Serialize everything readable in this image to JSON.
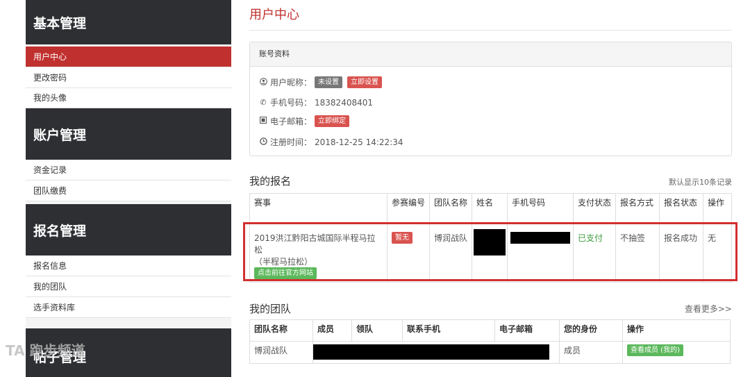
{
  "sidebar": {
    "sections": [
      {
        "title": "基本管理",
        "items": [
          "用户中心",
          "更改密码",
          "我的头像"
        ]
      },
      {
        "title": "账户管理",
        "items": [
          "资金记录",
          "团队缴费"
        ]
      },
      {
        "title": "报名管理",
        "items": [
          "报名信息",
          "我的团队",
          "选手资料库"
        ]
      },
      {
        "title": "帖子管理",
        "items": []
      }
    ],
    "active_item": "用户中心"
  },
  "page": {
    "title": "用户中心"
  },
  "account": {
    "panel_title": "账号资料",
    "nickname_label": "用户昵称：",
    "nickname_value": "未设置",
    "nickname_action": "立即设置",
    "phone_label": "手机号码：",
    "phone_value": "18382408401",
    "email_label": "电子邮箱：",
    "email_action": "立即绑定",
    "register_label": "注册时间：",
    "register_value": "2018-12-25 14:22:34",
    "icons": [
      "user-circle-icon",
      "phone-icon",
      "email-icon",
      "clock-icon"
    ]
  },
  "registrations": {
    "title": "我的报名",
    "note": "默认显示10条记录",
    "headers": [
      "赛事",
      "参赛编号",
      "团队名称",
      "姓名",
      "手机号码",
      "支付状态",
      "报名方式",
      "报名状态",
      "操作"
    ],
    "rows": [
      {
        "event_line1": "2019洪江黔阳古城国际半程马拉松",
        "event_line2": "（半程马拉松）",
        "event_link": "点击前往官方网站",
        "number": "暂无",
        "team": "博润战队",
        "name": "",
        "phone": "",
        "pay_status": "已支付",
        "method": "不抽签",
        "status": "报名成功",
        "action": "无"
      }
    ]
  },
  "teams": {
    "title": "我的团队",
    "more": "查看更多>>",
    "headers": [
      "团队名称",
      "成员",
      "领队",
      "联系手机",
      "电子邮箱",
      "您的身份",
      "操作"
    ],
    "rows": [
      {
        "name": "博润战队",
        "role": "成员",
        "action": "查看成员 (我的)"
      }
    ]
  },
  "watermark": "TA 跑步频道"
}
